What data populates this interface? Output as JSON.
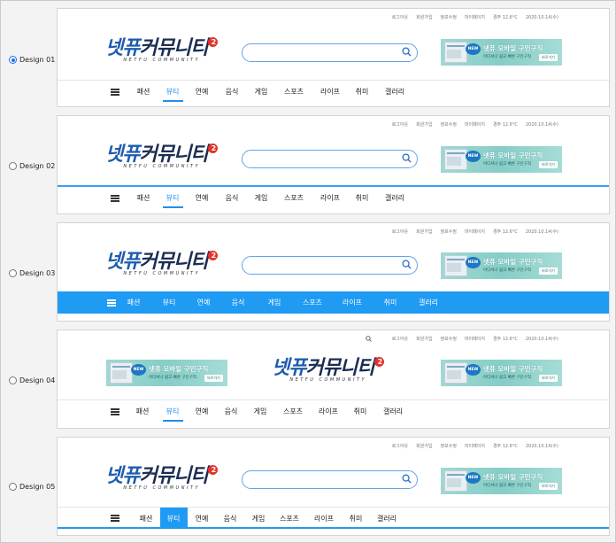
{
  "options": [
    {
      "label": "Design 01",
      "selected": true
    },
    {
      "label": "Design 02",
      "selected": false
    },
    {
      "label": "Design 03",
      "selected": false
    },
    {
      "label": "Design 04",
      "selected": false
    },
    {
      "label": "Design 05",
      "selected": false
    }
  ],
  "header": {
    "util_links": [
      "로그아웃",
      "회원가입",
      "정보수정",
      "마이페이지"
    ],
    "weather": "경주 12.6°C",
    "date": "2020.10.14(수)"
  },
  "logo": {
    "part1": "넷퓨",
    "part2": "커뮤니티",
    "badge": "2",
    "subtitle": "NETFU COMMUNITY"
  },
  "banner": {
    "new": "NEW",
    "title": "넷퓨 모바일 구인구직",
    "subtitle": "어디서나 쉽고 빠른 구인구직",
    "button": "바로가기"
  },
  "nav": [
    "패션",
    "뷰티",
    "연예",
    "음식",
    "게임",
    "스포츠",
    "라이프",
    "취미",
    "갤러리"
  ],
  "active_nav": "뷰티",
  "colors": {
    "accent": "#1f8ef0",
    "logo_blue": "#1e5cae",
    "logo_dark": "#1b2d52",
    "badge_red": "#e4322b"
  },
  "icons": [
    "search-icon",
    "hamburger-menu-icon"
  ]
}
